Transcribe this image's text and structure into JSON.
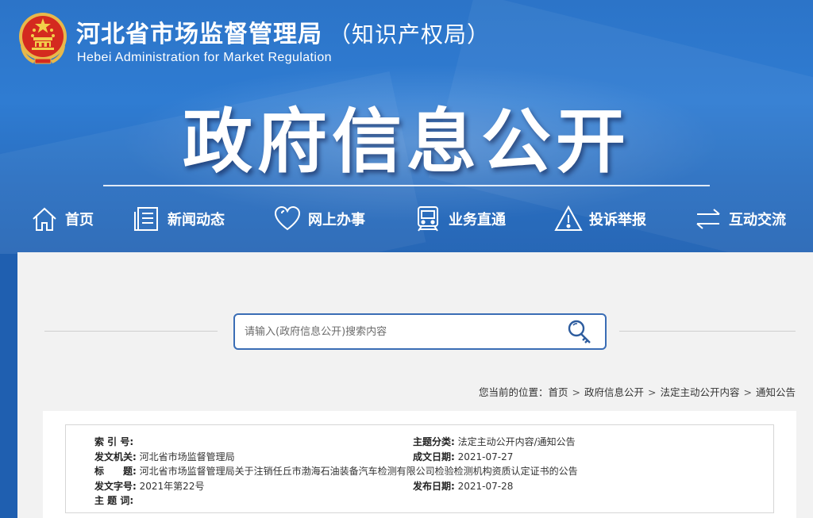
{
  "header": {
    "org_name_cn": "河北省市场监督管理局",
    "org_name_cn_sub": "（知识产权局）",
    "org_name_en": "Hebei Administration for Market Regulation",
    "main_title": "政府信息公开"
  },
  "nav": {
    "items": [
      {
        "label": "首页",
        "icon": "home-icon"
      },
      {
        "label": "新闻动态",
        "icon": "news-icon"
      },
      {
        "label": "网上办事",
        "icon": "heart-icon"
      },
      {
        "label": "业务直通",
        "icon": "train-icon"
      },
      {
        "label": "投诉举报",
        "icon": "warning-icon"
      },
      {
        "label": "互动交流",
        "icon": "exchange-icon"
      }
    ]
  },
  "search": {
    "placeholder": "请输入(政府信息公开)搜索内容",
    "icon": "search-key-icon"
  },
  "breadcrumb": {
    "prefix": "您当前的位置：",
    "items": [
      "首页",
      "政府信息公开",
      "法定主动公开内容",
      "通知公告"
    ],
    "separator": ">"
  },
  "info": {
    "index_no": {
      "label": "索 引 号:",
      "value": ""
    },
    "issuer": {
      "label": "发文机关:",
      "value": "河北省市场监督管理局"
    },
    "title": {
      "label": "标　　题:",
      "value": "河北省市场监督管理局关于注销任丘市渤海石油装备汽车检测有限公司检验检测机构资质认定证书的公告"
    },
    "doc_no": {
      "label": "发文字号:",
      "value": "2021年第22号"
    },
    "keywords": {
      "label": "主 题 词:",
      "value": ""
    },
    "category": {
      "label": "主题分类:",
      "value": "法定主动公开内容/通知公告"
    },
    "created_date": {
      "label": "成文日期:",
      "value": "2021-07-27"
    },
    "published_date": {
      "label": "发布日期:",
      "value": "2021-07-28"
    }
  },
  "colors": {
    "banner_blue": "#2c74c8",
    "search_border": "#3a6db5",
    "panel_bg": "#f2f2f2"
  }
}
